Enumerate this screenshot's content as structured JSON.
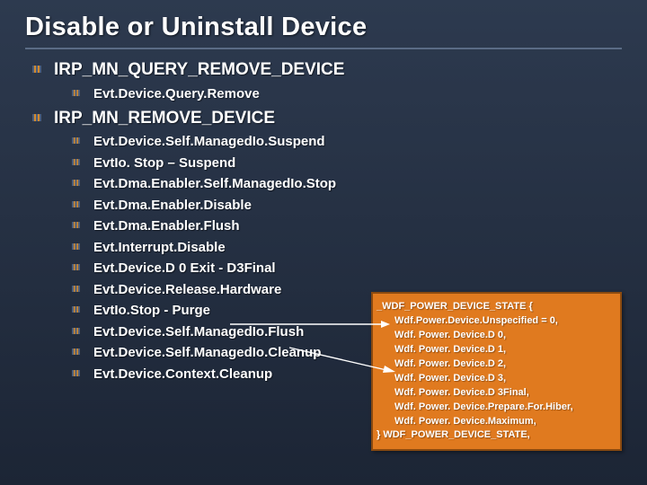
{
  "title": "Disable or Uninstall Device",
  "sections": [
    {
      "heading": "IRP_MN_QUERY_REMOVE_DEVICE",
      "items": [
        "Evt.Device.Query.Remove"
      ]
    },
    {
      "heading": "IRP_MN_REMOVE_DEVICE",
      "items": [
        "Evt.Device.Self.ManagedIo.Suspend",
        "EvtIo. Stop – Suspend",
        "Evt.Dma.Enabler.Self.ManagedIo.Stop",
        "Evt.Dma.Enabler.Disable",
        "Evt.Dma.Enabler.Flush",
        "Evt.Interrupt.Disable",
        "Evt.Device.D 0 Exit - D3Final",
        "Evt.Device.Release.Hardware",
        "EvtIo.Stop - Purge",
        "Evt.Device.Self.ManagedIo.Flush",
        "Evt.Device.Self.ManagedIo.Cleanup",
        "Evt.Device.Context.Cleanup"
      ]
    }
  ],
  "code": {
    "l0": "_WDF_POWER_DEVICE_STATE {",
    "l1": "Wdf.Power.Device.Unspecified = 0,",
    "l2": "Wdf. Power. Device.D 0,",
    "l3": "Wdf. Power. Device.D 1,",
    "l4": "Wdf. Power. Device.D 2,",
    "l5": "Wdf. Power. Device.D 3,",
    "l6": "Wdf. Power. Device.D 3Final,",
    "l7": "Wdf. Power. Device.Prepare.For.Hiber,",
    "l8": "Wdf. Power. Device.Maximum,",
    "l9": "} WDF_POWER_DEVICE_STATE,"
  }
}
